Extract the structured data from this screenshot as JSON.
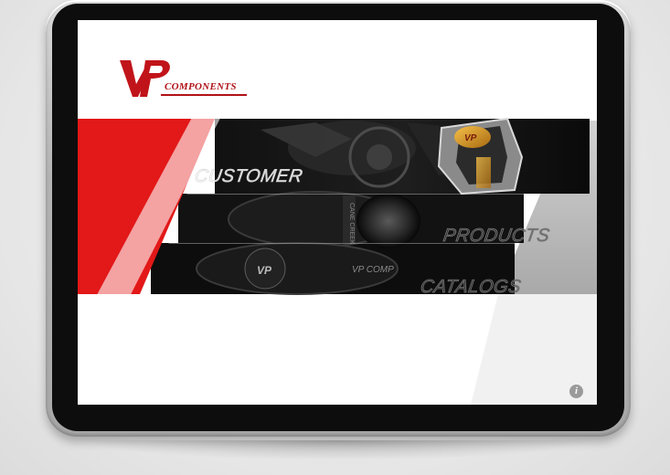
{
  "brand": {
    "logo_mark": "VP",
    "logo_text": "COMPONENTS"
  },
  "menu": {
    "customer": "CUSTOMER",
    "products": "PRODUCTS",
    "catalogs": "CATALOGS"
  },
  "product_print": {
    "cane_creek": "CANE CREEK",
    "vp_comp": "VP COMP"
  },
  "info": {
    "icon": "info-icon",
    "glyph": "i"
  },
  "colors": {
    "brand_red": "#e31818",
    "panel_gray": "#b5b5b5",
    "dark": "#0b0b0b"
  }
}
